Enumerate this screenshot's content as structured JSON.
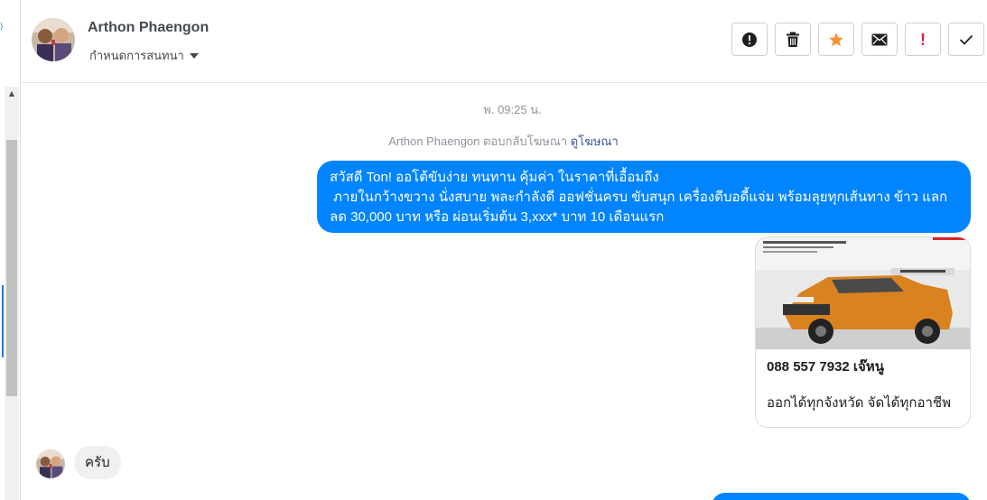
{
  "header": {
    "contact_name": "Arthon Phaengon",
    "assign_label": "กำหนดการสนทนา",
    "actions": [
      {
        "name": "mark-spam",
        "icon": "exclamation-circle-icon"
      },
      {
        "name": "delete",
        "icon": "trash-icon"
      },
      {
        "name": "star",
        "icon": "star-icon",
        "color": "#f7923b"
      },
      {
        "name": "mark-unread",
        "icon": "envelope-icon"
      },
      {
        "name": "follow-up",
        "icon": "red-exclamation-icon",
        "label": "!",
        "color": "#e41e3f"
      },
      {
        "name": "mark-done",
        "icon": "check-icon"
      }
    ]
  },
  "conversation": {
    "timestamp": "พ. 09:25 น.",
    "ad_reply_prefix": "Arthon Phaengon ตอบกลับโฆษณา",
    "ad_reply_link": "ดูโฆษณา",
    "outgoing_message": {
      "lines": [
        "สวัสดี Ton! ออโต้ขับง่าย ทนทาน คุ้มค่า ในราคาที่เอื้อมถึง",
        " ภายในกว้างขวาง นั่งสบาย พละกำลังดี ออฟชั่นครบ ขับสนุก เครื่องดีบอดี้แจ่ม พร้อมลุยทุกเส้นทาง ข้าว แลก",
        "ลด 30,000 บาท หรือ ผ่อนเริ่มต้น 3,xxx* บาท 10 เดือนแรก"
      ],
      "color": "#0084ff"
    },
    "ad_card": {
      "image": "orange-pickup-truck",
      "image_caption": "2020 NISSAN NAVARA DOUBLE CAB 2.5 CALIBRE EL BLACK AT SPORT",
      "title": "088 557 7932 เจ๊หนู",
      "description": "ออกได้ทุกจังหวัด จัดได้ทุกอาชีพ"
    },
    "incoming_message": {
      "text": "ครับ",
      "color": "#f1f0f0"
    }
  }
}
